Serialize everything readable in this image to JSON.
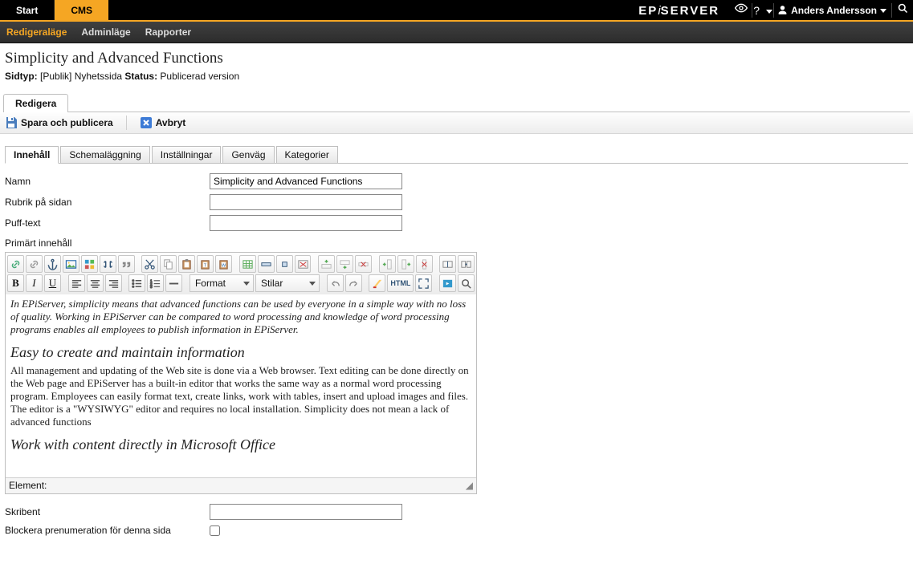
{
  "topbar": {
    "tabs": [
      "Start",
      "CMS"
    ],
    "activeTab": "CMS",
    "logo": "EPiSERVER",
    "user": "Anders Andersson"
  },
  "modebar": {
    "items": [
      "Redigeraläge",
      "Adminläge",
      "Rapporter"
    ],
    "active": "Redigeraläge"
  },
  "page": {
    "title": "Simplicity and Advanced Functions",
    "meta_label_type": "Sidtyp:",
    "meta_type_value": "[Publik] Nyhetssida",
    "meta_label_status": "Status:",
    "meta_status_value": "Publicerad version"
  },
  "editTab": "Redigera",
  "savebar": {
    "save": "Spara och publicera",
    "cancel": "Avbryt"
  },
  "contentTabs": [
    "Innehåll",
    "Schemaläggning",
    "Inställningar",
    "Genväg",
    "Kategorier"
  ],
  "contentTabsActive": "Innehåll",
  "form": {
    "name_label": "Namn",
    "name_value": "Simplicity and Advanced Functions",
    "heading_label": "Rubrik på sidan",
    "heading_value": "",
    "puff_label": "Puff-text",
    "puff_value": "",
    "primary_label": "Primärt innehåll",
    "writer_label": "Skribent",
    "writer_value": "",
    "block_label": "Blockera prenumeration för denna sida"
  },
  "editor": {
    "format_select": "Format",
    "styles_select": "Stilar",
    "html_button": "HTML",
    "content": {
      "lead": "In EPiServer, simplicity means that advanced functions can be used by everyone in a simple way with no loss of quality. Working in EPiServer can be compared to word processing and knowledge of word processing programs enables all employees to publish information in EPiServer.",
      "h1": "Easy to create and maintain information",
      "p1": "All management and updating of the Web site is done via a Web browser. Text editing can be done directly on the Web page and EPiServer has a built-in editor that works the same way as a normal word processing program. Employees can easily format text, create links, work with tables, insert and upload images and files. The editor is a \"WYSIWYG\" editor and requires no local installation. Simplicity does not mean a lack of advanced functions",
      "h2": "Work with content directly in Microsoft Office"
    },
    "statusbar_label": "Element:"
  }
}
